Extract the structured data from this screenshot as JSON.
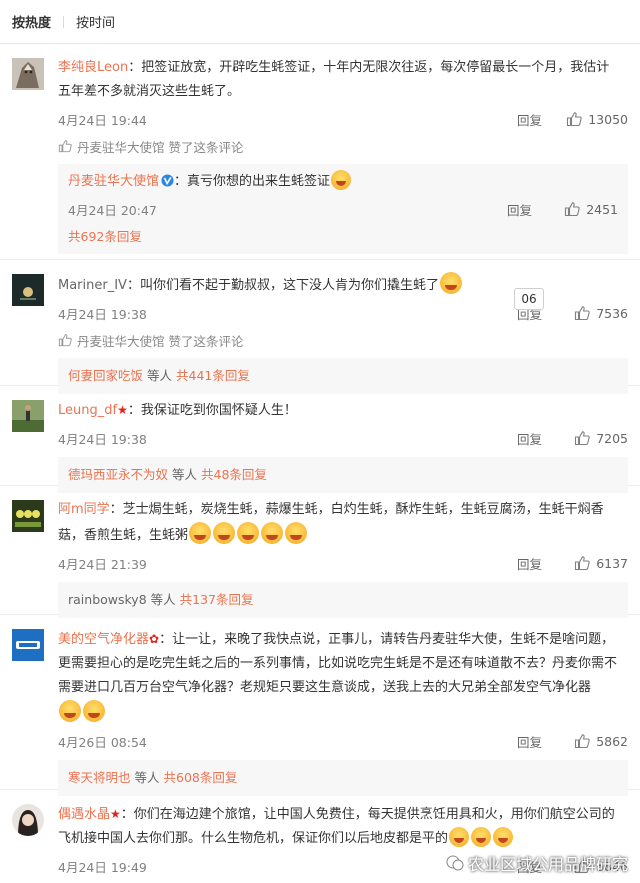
{
  "sort": {
    "hot": "按热度",
    "time": "按时间"
  },
  "common": {
    "reply": "回复",
    "liked_suffix": "赞了这条评论",
    "others": "等人"
  },
  "tag_06": "06",
  "watermark": "农业区域公用品牌研究",
  "comments": [
    {
      "user": "李纯良Leon",
      "text": "：把签证放宽，开辟吃生蚝签证，十年内无限次往返，每次停留最长一个月，我估计五年差不多就消灭这些生蚝了。",
      "time": "4月24日 19:44",
      "likes": "13050",
      "liked_by": "丹麦驻华大使馆",
      "sub_reply": {
        "user": "丹麦驻华大使馆",
        "text": "：真亏你想的出来生蚝签证",
        "time": "4月24日 20:47",
        "likes": "2451",
        "more": "共692条回复"
      }
    },
    {
      "user": "Mariner_IV",
      "text": "：叫你们看不起于勤叔叔，这下没人肯为你们撬生蚝了",
      "time": "4月24日 19:38",
      "likes": "7536",
      "liked_by": "丹麦驻华大使馆",
      "more_user": "何妻回家吃饭",
      "more": "共441条回复"
    },
    {
      "user": "Leung_df",
      "text": "：我保证吃到你国怀疑人生！",
      "time": "4月24日 19:38",
      "likes": "7205",
      "more_user": "德玛西亚永不为奴",
      "more": "共48条回复"
    },
    {
      "user": "阿m同学",
      "text": "：芝士焗生蚝，炭烧生蚝，蒜爆生蚝，白灼生蚝，酥炸生蚝，生蚝豆腐汤，生蚝干焖香菇，香煎生蚝，生蚝粥",
      "time": "4月24日 21:39",
      "likes": "6137",
      "more_user": "rainbowsky8",
      "more": "共137条回复"
    },
    {
      "user": "美的空气净化器",
      "text": "：让一让，来晚了我快点说，正事儿，请转告丹麦驻华大使，生蚝不是啥问题，更需要担心的是吃完生蚝之后的一系列事情，比如说吃完生蚝是不是还有味道散不去？丹麦你需不需要进口几百万台空气净化器？老规矩只要这生意谈成，送我上去的大兄弟全部发空气净化器",
      "time": "4月26日 08:54",
      "likes": "5862",
      "more_user": "寒天将明也",
      "more": "共608条回复"
    },
    {
      "user": "偶遇水晶",
      "text": "：你们在海边建个旅馆，让中国人免费住，每天提供烹饪用具和火，用你们航空公司的飞机接中国人去你们那。什么生物危机，保证你们以后地皮都是平的",
      "time": "4月24日 19:49",
      "likes": "5846"
    }
  ]
}
